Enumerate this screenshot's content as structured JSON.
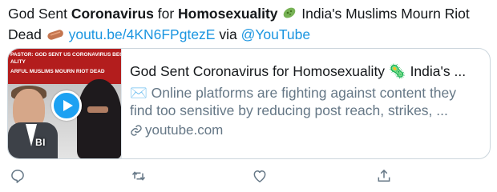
{
  "tweet": {
    "text_lead": "God Sent ",
    "bold_1": "Coronavirus",
    "text_mid": " for ",
    "bold_2": "Homosexuality",
    "text_after_emoji": " India's Muslims Mourn Riot Dead",
    "link_url": "youtu.be/4KN6FPgtezE",
    "via_text": " via ",
    "via_handle": "@YouTube"
  },
  "card": {
    "thumbnail_lines": [
      "PASTOR: GOD SENT US CORONAVIRUS BECAUSE",
      "ALITY",
      "ARFUL MUSLIMS MOURN RIOT DEAD"
    ],
    "thumbnail_watermark": "BI",
    "title": "God Sent Coronavirus for Homosexuality 🦠 India's ...",
    "description_emoji": "✉️",
    "description": " Online platforms are fighting against content they find too sensitive by reducing post reach, strikes, ...",
    "domain": "youtube.com"
  },
  "icons": {
    "reply": "reply-icon",
    "retweet": "retweet-icon",
    "like": "like-icon",
    "share": "share-icon"
  },
  "colors": {
    "link": "#1b95e0",
    "secondary_text": "#657786",
    "play_button": "#1da1f2"
  }
}
